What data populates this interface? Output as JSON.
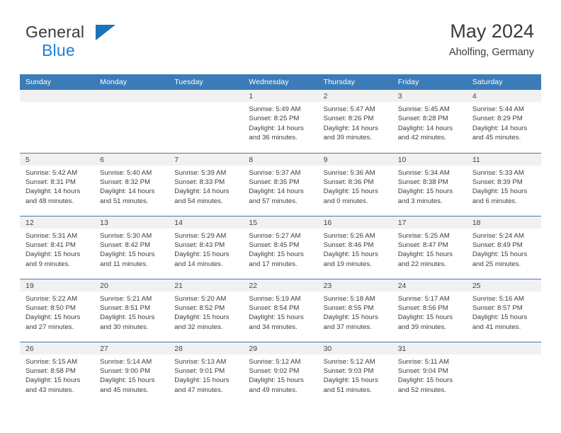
{
  "brand": {
    "name_top": "General",
    "name_bottom": "Blue",
    "accent_color": "#1b73ba",
    "triangle_icon": "triangle-icon"
  },
  "header": {
    "title": "May 2024",
    "subtitle": "Aholfing, Germany"
  },
  "theme": {
    "header_row_bg": "#3b7cb8",
    "daynum_band_bg": "#f1f1f1",
    "grid_line": "#3b7cb8",
    "text": "#3d3d3d"
  },
  "weekday_headers": [
    "Sunday",
    "Monday",
    "Tuesday",
    "Wednesday",
    "Thursday",
    "Friday",
    "Saturday"
  ],
  "weeks": [
    [
      {
        "empty": true
      },
      {
        "empty": true
      },
      {
        "empty": true
      },
      {
        "day": "1",
        "sunrise": "Sunrise: 5:49 AM",
        "sunset": "Sunset: 8:25 PM",
        "daylight_1": "Daylight: 14 hours",
        "daylight_2": "and 36 minutes."
      },
      {
        "day": "2",
        "sunrise": "Sunrise: 5:47 AM",
        "sunset": "Sunset: 8:26 PM",
        "daylight_1": "Daylight: 14 hours",
        "daylight_2": "and 39 minutes."
      },
      {
        "day": "3",
        "sunrise": "Sunrise: 5:45 AM",
        "sunset": "Sunset: 8:28 PM",
        "daylight_1": "Daylight: 14 hours",
        "daylight_2": "and 42 minutes."
      },
      {
        "day": "4",
        "sunrise": "Sunrise: 5:44 AM",
        "sunset": "Sunset: 8:29 PM",
        "daylight_1": "Daylight: 14 hours",
        "daylight_2": "and 45 minutes."
      }
    ],
    [
      {
        "day": "5",
        "sunrise": "Sunrise: 5:42 AM",
        "sunset": "Sunset: 8:31 PM",
        "daylight_1": "Daylight: 14 hours",
        "daylight_2": "and 48 minutes."
      },
      {
        "day": "6",
        "sunrise": "Sunrise: 5:40 AM",
        "sunset": "Sunset: 8:32 PM",
        "daylight_1": "Daylight: 14 hours",
        "daylight_2": "and 51 minutes."
      },
      {
        "day": "7",
        "sunrise": "Sunrise: 5:39 AM",
        "sunset": "Sunset: 8:33 PM",
        "daylight_1": "Daylight: 14 hours",
        "daylight_2": "and 54 minutes."
      },
      {
        "day": "8",
        "sunrise": "Sunrise: 5:37 AM",
        "sunset": "Sunset: 8:35 PM",
        "daylight_1": "Daylight: 14 hours",
        "daylight_2": "and 57 minutes."
      },
      {
        "day": "9",
        "sunrise": "Sunrise: 5:36 AM",
        "sunset": "Sunset: 8:36 PM",
        "daylight_1": "Daylight: 15 hours",
        "daylight_2": "and 0 minutes."
      },
      {
        "day": "10",
        "sunrise": "Sunrise: 5:34 AM",
        "sunset": "Sunset: 8:38 PM",
        "daylight_1": "Daylight: 15 hours",
        "daylight_2": "and 3 minutes."
      },
      {
        "day": "11",
        "sunrise": "Sunrise: 5:33 AM",
        "sunset": "Sunset: 8:39 PM",
        "daylight_1": "Daylight: 15 hours",
        "daylight_2": "and 6 minutes."
      }
    ],
    [
      {
        "day": "12",
        "sunrise": "Sunrise: 5:31 AM",
        "sunset": "Sunset: 8:41 PM",
        "daylight_1": "Daylight: 15 hours",
        "daylight_2": "and 9 minutes."
      },
      {
        "day": "13",
        "sunrise": "Sunrise: 5:30 AM",
        "sunset": "Sunset: 8:42 PM",
        "daylight_1": "Daylight: 15 hours",
        "daylight_2": "and 11 minutes."
      },
      {
        "day": "14",
        "sunrise": "Sunrise: 5:29 AM",
        "sunset": "Sunset: 8:43 PM",
        "daylight_1": "Daylight: 15 hours",
        "daylight_2": "and 14 minutes."
      },
      {
        "day": "15",
        "sunrise": "Sunrise: 5:27 AM",
        "sunset": "Sunset: 8:45 PM",
        "daylight_1": "Daylight: 15 hours",
        "daylight_2": "and 17 minutes."
      },
      {
        "day": "16",
        "sunrise": "Sunrise: 5:26 AM",
        "sunset": "Sunset: 8:46 PM",
        "daylight_1": "Daylight: 15 hours",
        "daylight_2": "and 19 minutes."
      },
      {
        "day": "17",
        "sunrise": "Sunrise: 5:25 AM",
        "sunset": "Sunset: 8:47 PM",
        "daylight_1": "Daylight: 15 hours",
        "daylight_2": "and 22 minutes."
      },
      {
        "day": "18",
        "sunrise": "Sunrise: 5:24 AM",
        "sunset": "Sunset: 8:49 PM",
        "daylight_1": "Daylight: 15 hours",
        "daylight_2": "and 25 minutes."
      }
    ],
    [
      {
        "day": "19",
        "sunrise": "Sunrise: 5:22 AM",
        "sunset": "Sunset: 8:50 PM",
        "daylight_1": "Daylight: 15 hours",
        "daylight_2": "and 27 minutes."
      },
      {
        "day": "20",
        "sunrise": "Sunrise: 5:21 AM",
        "sunset": "Sunset: 8:51 PM",
        "daylight_1": "Daylight: 15 hours",
        "daylight_2": "and 30 minutes."
      },
      {
        "day": "21",
        "sunrise": "Sunrise: 5:20 AM",
        "sunset": "Sunset: 8:52 PM",
        "daylight_1": "Daylight: 15 hours",
        "daylight_2": "and 32 minutes."
      },
      {
        "day": "22",
        "sunrise": "Sunrise: 5:19 AM",
        "sunset": "Sunset: 8:54 PM",
        "daylight_1": "Daylight: 15 hours",
        "daylight_2": "and 34 minutes."
      },
      {
        "day": "23",
        "sunrise": "Sunrise: 5:18 AM",
        "sunset": "Sunset: 8:55 PM",
        "daylight_1": "Daylight: 15 hours",
        "daylight_2": "and 37 minutes."
      },
      {
        "day": "24",
        "sunrise": "Sunrise: 5:17 AM",
        "sunset": "Sunset: 8:56 PM",
        "daylight_1": "Daylight: 15 hours",
        "daylight_2": "and 39 minutes."
      },
      {
        "day": "25",
        "sunrise": "Sunrise: 5:16 AM",
        "sunset": "Sunset: 8:57 PM",
        "daylight_1": "Daylight: 15 hours",
        "daylight_2": "and 41 minutes."
      }
    ],
    [
      {
        "day": "26",
        "sunrise": "Sunrise: 5:15 AM",
        "sunset": "Sunset: 8:58 PM",
        "daylight_1": "Daylight: 15 hours",
        "daylight_2": "and 43 minutes."
      },
      {
        "day": "27",
        "sunrise": "Sunrise: 5:14 AM",
        "sunset": "Sunset: 9:00 PM",
        "daylight_1": "Daylight: 15 hours",
        "daylight_2": "and 45 minutes."
      },
      {
        "day": "28",
        "sunrise": "Sunrise: 5:13 AM",
        "sunset": "Sunset: 9:01 PM",
        "daylight_1": "Daylight: 15 hours",
        "daylight_2": "and 47 minutes."
      },
      {
        "day": "29",
        "sunrise": "Sunrise: 5:12 AM",
        "sunset": "Sunset: 9:02 PM",
        "daylight_1": "Daylight: 15 hours",
        "daylight_2": "and 49 minutes."
      },
      {
        "day": "30",
        "sunrise": "Sunrise: 5:12 AM",
        "sunset": "Sunset: 9:03 PM",
        "daylight_1": "Daylight: 15 hours",
        "daylight_2": "and 51 minutes."
      },
      {
        "day": "31",
        "sunrise": "Sunrise: 5:11 AM",
        "sunset": "Sunset: 9:04 PM",
        "daylight_1": "Daylight: 15 hours",
        "daylight_2": "and 52 minutes."
      },
      {
        "empty": true
      }
    ]
  ]
}
